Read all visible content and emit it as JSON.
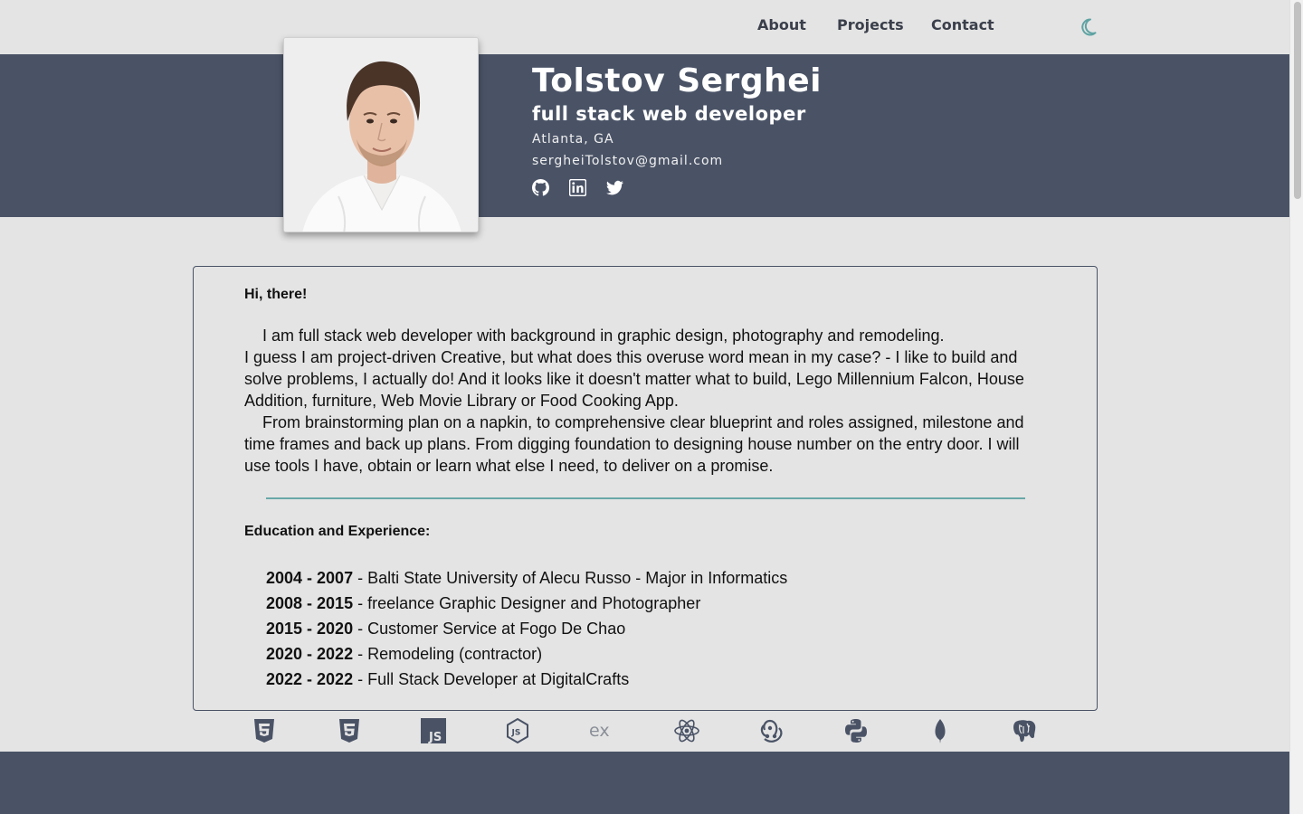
{
  "nav": {
    "about": "About",
    "projects": "Projects",
    "contact": "Contact",
    "theme_icon": "moon-icon",
    "accent_color": "#5fa3a3"
  },
  "profile": {
    "name": "Tolstov Serghei",
    "title": "full stack web developer",
    "location": "Atlanta, GA",
    "email": "sergheiTolstov@gmail.com",
    "socials": [
      "github-icon",
      "linkedin-icon",
      "twitter-icon"
    ]
  },
  "about": {
    "greeting": "Hi, there!",
    "bio_p1": "I am full stack web developer with background in graphic design, photography and remodeling.",
    "bio_p2": "I guess I am project-driven Creative, but what does this overuse word mean in my case? - I like to build and solve problems, I actually do! And it looks like it doesn't matter what to build, Lego Millennium Falcon, House Addition, furniture, Web Movie Library or Food Cooking App.",
    "bio_p3": "From brainstorming plan on a napkin, to comprehensive clear blueprint and roles assigned, milestone and time frames and back up plans. From digging foundation to designing house number on the entry door. I will use tools I have, obtain or learn what else I need, to deliver on a promise.",
    "edu_heading": "Education and Experience:",
    "education": [
      {
        "years": "2004 - 2007",
        "desc": " - Balti State University of Alecu Russo - Major in Informatics"
      },
      {
        "years": "2008 - 2015",
        "desc": " - freelance Graphic Designer and Photographer"
      },
      {
        "years": "2015 - 2020",
        "desc": " - Customer Service at Fogo De Chao"
      },
      {
        "years": "2020 - 2022",
        "desc": " - Remodeling (contractor)"
      },
      {
        "years": "2022 - 2022",
        "desc": " - Full Stack Developer at DigitalCrafts"
      }
    ]
  },
  "tech_icons": [
    "html5-icon",
    "css3-icon",
    "javascript-icon",
    "nodejs-icon",
    "express-icon",
    "react-icon",
    "redux-icon",
    "python-icon",
    "mongodb-icon",
    "postgresql-icon"
  ],
  "colors": {
    "header_band": "#4a5366",
    "page_bg": "#e4e4e4",
    "divider": "#6aa8a8"
  }
}
